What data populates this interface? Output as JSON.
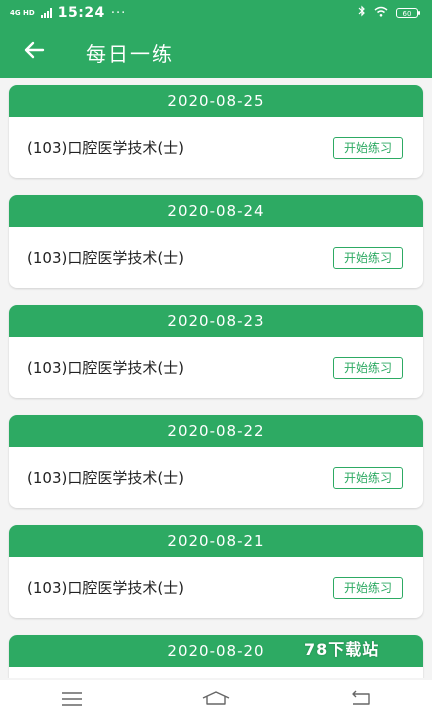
{
  "status_bar": {
    "network": "4G HD",
    "time": "15:24",
    "dots": "···",
    "battery": "60"
  },
  "header": {
    "title": "每日一练"
  },
  "cards": [
    {
      "date": "2020-08-25",
      "subject": "(103)口腔医学技术(士)",
      "button": "开始练习"
    },
    {
      "date": "2020-08-24",
      "subject": "(103)口腔医学技术(士)",
      "button": "开始练习"
    },
    {
      "date": "2020-08-23",
      "subject": "(103)口腔医学技术(士)",
      "button": "开始练习"
    },
    {
      "date": "2020-08-22",
      "subject": "(103)口腔医学技术(士)",
      "button": "开始练习"
    },
    {
      "date": "2020-08-21",
      "subject": "(103)口腔医学技术(士)",
      "button": "开始练习"
    },
    {
      "date": "2020-08-20"
    }
  ],
  "watermark": "78下载站",
  "colors": {
    "accent": "#2daa63",
    "background": "#f4f4f4",
    "card": "#ffffff"
  },
  "icons": {
    "back": "arrow-left-icon",
    "bluetooth": "bluetooth-icon",
    "wifi": "wifi-icon",
    "menu": "menu-icon",
    "home": "home-icon",
    "return": "return-icon"
  }
}
